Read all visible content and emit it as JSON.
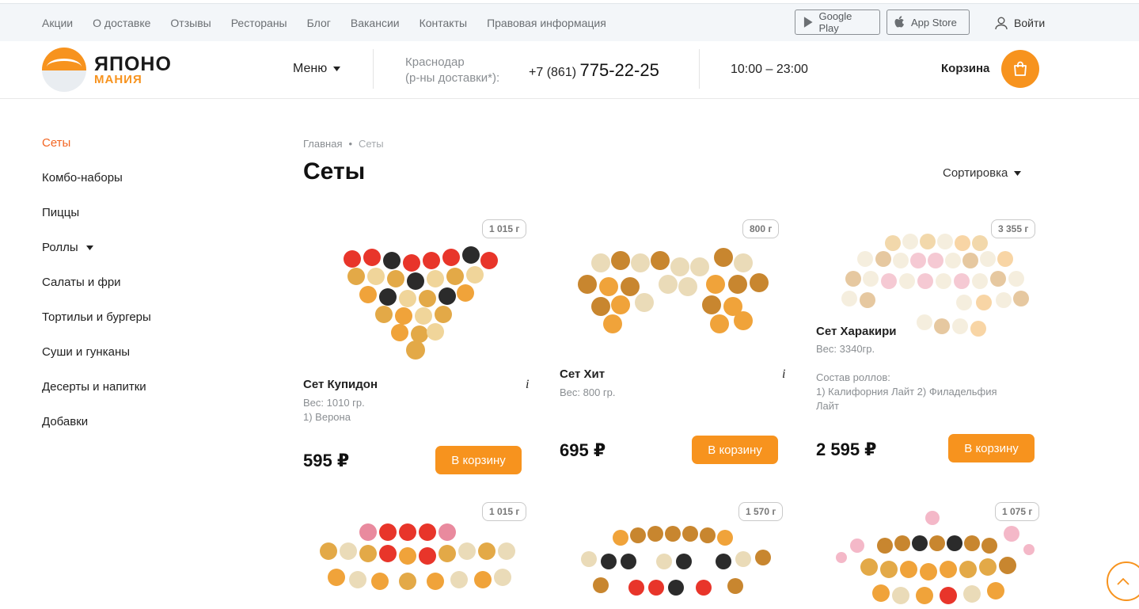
{
  "topnav": {
    "items": [
      "Акции",
      "О доставке",
      "Отзывы",
      "Рестораны",
      "Блог",
      "Вакансии",
      "Контакты",
      "Правовая информация"
    ],
    "google_play": "Google Play",
    "app_store": "App Store",
    "login": "Войти"
  },
  "header": {
    "logo_line1": "ЯПОНО",
    "logo_line2": "МАНИЯ",
    "menu": "Меню",
    "city_line1": "Краснодар",
    "city_line2": "(р-ны доставки*):",
    "phone_prefix": "+7 (861)",
    "phone_number": "775-22-25",
    "hours": "10:00 – 23:00",
    "cart": "Корзина"
  },
  "sidebar": {
    "items": [
      "Сеты",
      "Комбо-наборы",
      "Пиццы",
      "Роллы",
      "Салаты и фри",
      "Тортильи и бургеры",
      "Суши и гунканы",
      "Десерты и напитки",
      "Добавки"
    ]
  },
  "breadcrumb": {
    "home": "Главная",
    "separator": "•",
    "current": "Сеты"
  },
  "page": {
    "title": "Сеты",
    "sort": "Сортировка"
  },
  "products": [
    {
      "weight": "1 015 г",
      "name": "Сет Купидон",
      "desc1": "Вес: 1010 гр.",
      "desc2": "1) Верона",
      "price": "595 ₽",
      "button": "В корзину",
      "info": "i"
    },
    {
      "weight": "800 г",
      "name": "Сет Хит",
      "desc1": "Вес: 800 гр.",
      "price": "695 ₽",
      "button": "В корзину",
      "info": "i"
    },
    {
      "weight": "3 355 г",
      "name": "Сет Харакири",
      "desc1": "Вес: 3340гр.",
      "desc2": "Состав роллов:",
      "desc3": "1) Калифорния Лайт 2) Филадельфия",
      "desc4": "Лайт",
      "price": "2 595 ₽",
      "button": "В корзину"
    },
    {
      "weight": "1 015 г"
    },
    {
      "weight": "1 570 г"
    },
    {
      "weight": "1 075 г"
    }
  ],
  "colors": {
    "accent": "#f7931e",
    "active_link": "#f26522",
    "topbar_bg": "#f3f6f9"
  },
  "icons": [
    "google-play-icon",
    "apple-icon",
    "user-icon",
    "caret-down-icon",
    "shopping-bag-icon",
    "chevron-up-icon"
  ]
}
